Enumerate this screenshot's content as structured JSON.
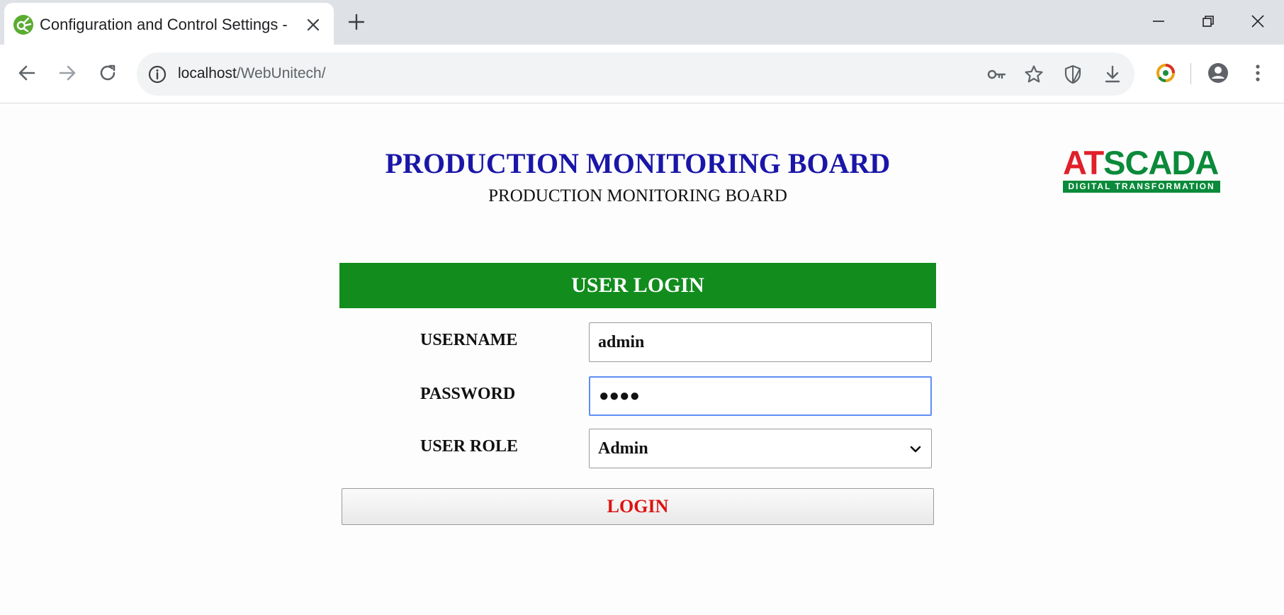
{
  "browser": {
    "tab_title": "Configuration and Control Settings -",
    "url_host": "localhost",
    "url_path": "/WebUnitech/"
  },
  "page": {
    "title": "PRODUCTION MONITORING BOARD",
    "subtitle": "PRODUCTION MONITORING BOARD"
  },
  "logo": {
    "brand_part1": "AT",
    "brand_part2": "SCADA",
    "tagline": "DIGITAL TRANSFORMATION",
    "colors": {
      "red": "#e0202a",
      "green": "#0a8a3a"
    }
  },
  "login": {
    "header": "USER LOGIN",
    "username_label": "USERNAME",
    "username_value": "admin",
    "password_label": "PASSWORD",
    "password_value": "●●●●",
    "role_label": "USER ROLE",
    "role_value": "Admin",
    "button_label": "LOGIN"
  },
  "colors": {
    "header_bg": "#128c1d",
    "title_color": "#1a16a8",
    "button_text": "#e01010",
    "focus_border": "#5b8ff5"
  }
}
